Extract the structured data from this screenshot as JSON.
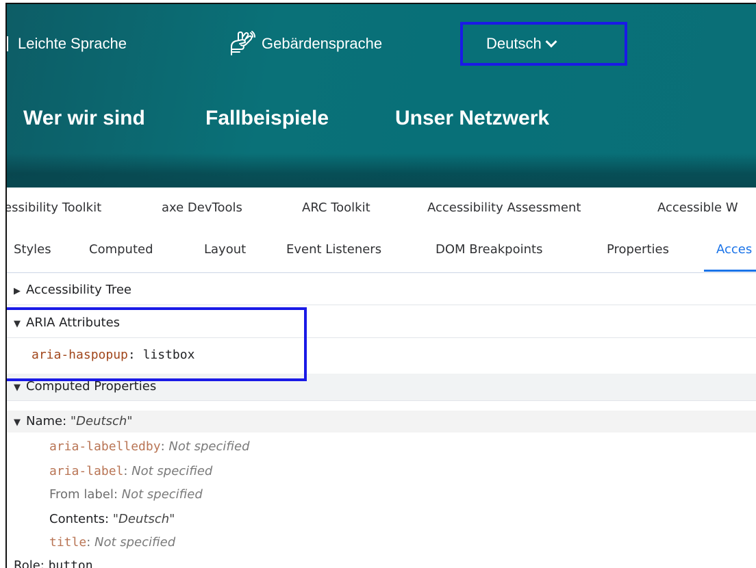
{
  "site": {
    "topbar": {
      "leichte_sprache": "Leichte Sprache",
      "gebaerdensprache": "Gebärdensprache",
      "language_button": "Deutsch"
    },
    "nav": [
      "Wer wir sind",
      "Fallbeispiele",
      "Unser Netzwerk"
    ]
  },
  "devtools": {
    "extension_tabs": [
      "essibility Toolkit",
      "axe DevTools",
      "ARC Toolkit",
      "Accessibility Assessment",
      "Accessible W"
    ],
    "sidebar_tabs": [
      "Styles",
      "Computed",
      "Layout",
      "Event Listeners",
      "DOM Breakpoints",
      "Properties",
      "Acces"
    ],
    "active_sidebar_tab": "Acces",
    "sections": {
      "accessibility_tree": "Accessibility Tree",
      "aria_attributes": "ARIA Attributes",
      "computed_properties": "Computed Properties"
    },
    "aria_attr": {
      "name": "aria-haspopup",
      "value": "listbox"
    },
    "computed": {
      "name_label": "Name: ",
      "name_value": "\"Deutsch\"",
      "labelledby_key": "aria-labelledby",
      "labelledby_val": "Not specified",
      "label_key": "aria-label",
      "label_val": "Not specified",
      "from_label_key": "From label: ",
      "from_label_val": "Not specified",
      "contents_key": "Contents: ",
      "contents_val": "\"Deutsch\"",
      "title_key": "title",
      "title_val": "Not specified",
      "role_key": "Role: ",
      "role_val": "button"
    }
  },
  "colors": {
    "site_teal": "#0a7178",
    "highlight_blue": "#1a1ae6",
    "active_tab_blue": "#1a73e8",
    "attr_name_brown": "#a1461b"
  }
}
